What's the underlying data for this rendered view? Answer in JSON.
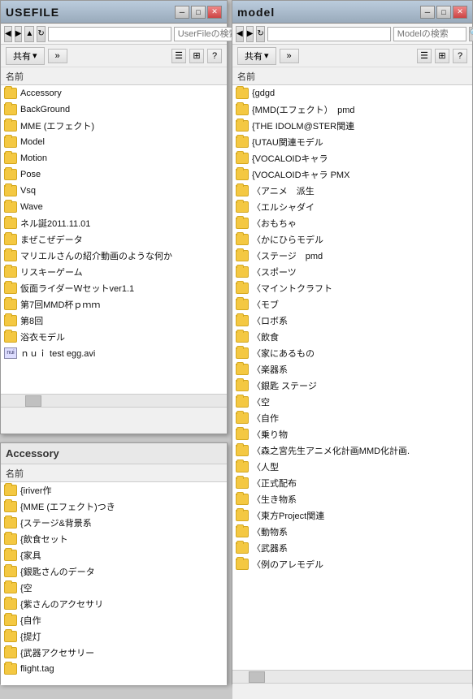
{
  "windows": {
    "userfile": {
      "title": "USEFILE",
      "search_placeholder": "UserFileの検索",
      "toolbar_share": "共有",
      "toolbar_arrange": "",
      "column_name": "名前",
      "files": [
        {
          "name": "Accessory",
          "type": "folder"
        },
        {
          "name": "BackGround",
          "type": "folder"
        },
        {
          "name": "MME (エフェクト)",
          "type": "folder"
        },
        {
          "name": "Model",
          "type": "folder"
        },
        {
          "name": "Motion",
          "type": "folder"
        },
        {
          "name": "Pose",
          "type": "folder"
        },
        {
          "name": "Vsq",
          "type": "folder"
        },
        {
          "name": "Wave",
          "type": "folder"
        },
        {
          "name": "ネル誕2011.11.01",
          "type": "folder"
        },
        {
          "name": "まぜこぜデータ",
          "type": "folder"
        },
        {
          "name": "マリエルさんの紹介動画のような何か",
          "type": "folder"
        },
        {
          "name": "リスキーゲーム",
          "type": "folder"
        },
        {
          "name": "仮面ライダーＷセットver1.1",
          "type": "folder"
        },
        {
          "name": "第7回MMD杯ｐｍｍ",
          "type": "folder"
        },
        {
          "name": "第8回",
          "type": "folder"
        },
        {
          "name": "浴衣モデル",
          "type": "folder"
        },
        {
          "name": "ｎｕｉ test egg.avi",
          "type": "avi"
        }
      ]
    },
    "model": {
      "title": "model",
      "search_placeholder": "Modelの検索",
      "toolbar_share": "共有",
      "column_name": "名前",
      "files": [
        {
          "name": "{gdgd",
          "type": "folder"
        },
        {
          "name": "{MMD(エフェクト）　pmd",
          "type": "folder"
        },
        {
          "name": "{THE IDOLM@STER関連",
          "type": "folder"
        },
        {
          "name": "{UTAU関連モデル",
          "type": "folder"
        },
        {
          "name": "{VOCALOIDキャラ",
          "type": "folder"
        },
        {
          "name": "{VOCALOIDキャラ PMX",
          "type": "folder"
        },
        {
          "name": "〈アニメ　派生",
          "type": "folder"
        },
        {
          "name": "〈エルシャダイ",
          "type": "folder"
        },
        {
          "name": "〈おもちゃ",
          "type": "folder"
        },
        {
          "name": "〈かにひらモデル",
          "type": "folder"
        },
        {
          "name": "〈ステージ　pmd",
          "type": "folder"
        },
        {
          "name": "〈スポーツ",
          "type": "folder"
        },
        {
          "name": "〈マイントクラフト",
          "type": "folder"
        },
        {
          "name": "〈モブ",
          "type": "folder"
        },
        {
          "name": "〈ロボ系",
          "type": "folder"
        },
        {
          "name": "〈飲食",
          "type": "folder"
        },
        {
          "name": "〈家にあるもの",
          "type": "folder"
        },
        {
          "name": "〈楽器系",
          "type": "folder"
        },
        {
          "name": "〈銀匙 ステージ",
          "type": "folder"
        },
        {
          "name": "〈空",
          "type": "folder"
        },
        {
          "name": "〈自作",
          "type": "folder"
        },
        {
          "name": "〈乗り物",
          "type": "folder"
        },
        {
          "name": "〈森之宮先生アニメ化計画MMD化計画.",
          "type": "folder"
        },
        {
          "name": "〈人型",
          "type": "folder"
        },
        {
          "name": "〈正式配布",
          "type": "folder"
        },
        {
          "name": "〈生き物系",
          "type": "folder"
        },
        {
          "name": "〈東方Project関連",
          "type": "folder"
        },
        {
          "name": "〈動物系",
          "type": "folder"
        },
        {
          "name": "〈武器系",
          "type": "folder"
        },
        {
          "name": "〈例のアレモデル",
          "type": "folder"
        }
      ]
    },
    "accessory": {
      "title": "Accessory",
      "column_name": "名前",
      "files": [
        {
          "name": "{iriver作",
          "type": "folder"
        },
        {
          "name": "{MME (エフェクト)つき",
          "type": "folder"
        },
        {
          "name": "{ステージ&背景系",
          "type": "folder"
        },
        {
          "name": "{飲食セット",
          "type": "folder"
        },
        {
          "name": "{家具",
          "type": "folder"
        },
        {
          "name": "{銀匙さんのデータ",
          "type": "folder"
        },
        {
          "name": "{空",
          "type": "folder"
        },
        {
          "name": "{紫さんのアクセサリ",
          "type": "folder"
        },
        {
          "name": "{自作",
          "type": "folder"
        },
        {
          "name": "{提灯",
          "type": "folder"
        },
        {
          "name": "{武器アクセサリー",
          "type": "folder"
        },
        {
          "name": "flight.tag",
          "type": "folder"
        }
      ]
    }
  },
  "icons": {
    "minimize": "─",
    "maximize": "□",
    "close": "✕",
    "back": "◀",
    "forward": "▶",
    "up": "▲",
    "refresh": "↻",
    "search": "🔍",
    "question": "?"
  }
}
